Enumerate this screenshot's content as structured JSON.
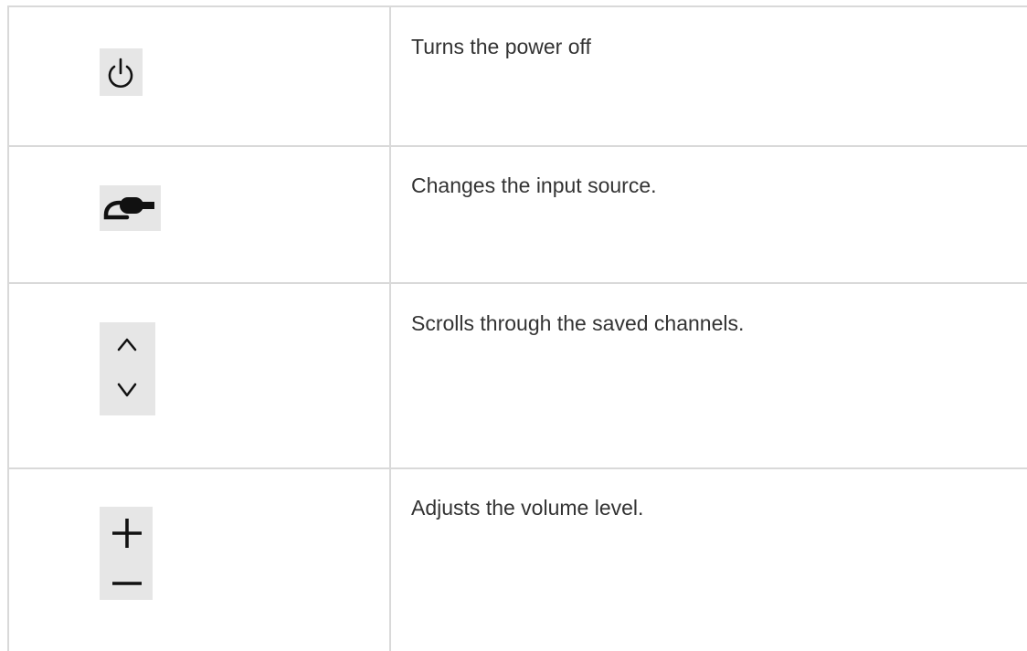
{
  "rows": [
    {
      "icon": "power-icon",
      "text": "Turns the power off"
    },
    {
      "icon": "input-source-icon",
      "text": "Changes the input source."
    },
    {
      "icon": "channel-up-down-icon",
      "text": "Scrolls through the saved channels."
    },
    {
      "icon": "volume-plus-minus-icon",
      "text": "Adjusts the volume level."
    }
  ],
  "colors": {
    "border": "#d9d9d9",
    "icon_bg": "#e6e6e6",
    "icon": "#111111",
    "text": "#333333"
  }
}
